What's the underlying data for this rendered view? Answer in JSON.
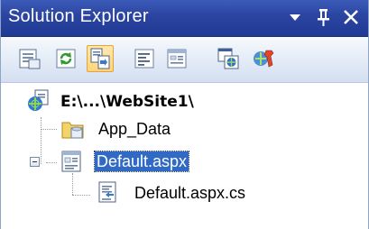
{
  "window": {
    "title": "Solution Explorer",
    "buttons": [
      {
        "name": "window-position-dropdown",
        "icon": "chevron-down-icon"
      },
      {
        "name": "auto-hide-pin",
        "icon": "pin-icon"
      },
      {
        "name": "close",
        "icon": "close-icon"
      }
    ]
  },
  "toolbar": {
    "buttons": [
      {
        "icon": "properties-icon",
        "active": false
      },
      {
        "icon": "refresh-icon",
        "active": false
      },
      {
        "icon": "nest-related-files-icon",
        "active": true
      },
      {
        "icon": "view-code-icon",
        "active": false
      },
      {
        "icon": "view-designer-icon",
        "active": false
      },
      {
        "icon": "copy-web-site-icon",
        "active": false
      },
      {
        "icon": "asp-net-configuration-icon",
        "active": false
      }
    ]
  },
  "tree": {
    "root": {
      "label": "E:\\...\\WebSite1\\",
      "icon": "website-icon"
    },
    "items": [
      {
        "label": "App_Data",
        "icon": "folder-icon",
        "selected": false
      },
      {
        "label": "Default.aspx",
        "icon": "aspx-page-icon",
        "selected": true,
        "expanded": true
      },
      {
        "label": "Default.aspx.cs",
        "icon": "cs-code-file-icon",
        "selected": false
      }
    ]
  },
  "colors": {
    "titlebar": "#2a44a0",
    "selection": "#316ac5",
    "toolbar": "#e3ebf6"
  }
}
